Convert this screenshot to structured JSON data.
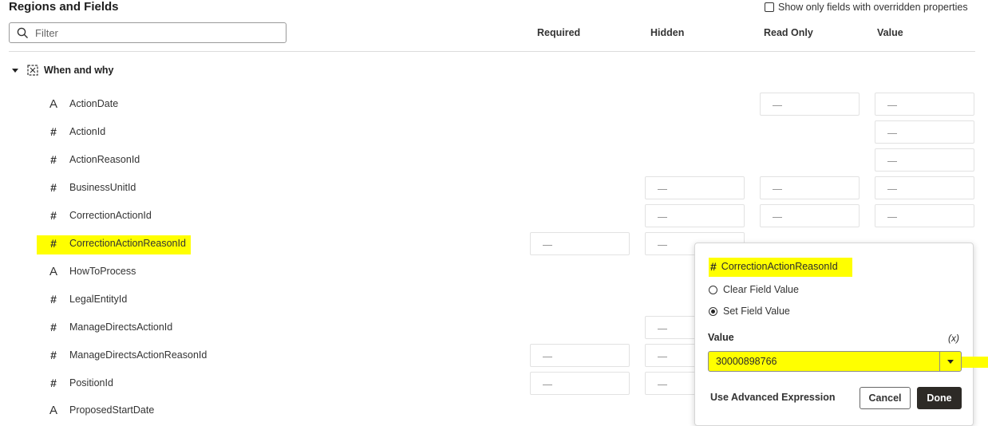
{
  "header": {
    "title": "Regions and Fields",
    "overridden_label": "Show only fields with overridden properties",
    "filter_placeholder": "Filter"
  },
  "columns": [
    "Required",
    "Hidden",
    "Read Only",
    "Value"
  ],
  "region": {
    "label": "When and why"
  },
  "fields": [
    {
      "name": "ActionDate",
      "type_icon": "text-icon"
    },
    {
      "name": "ActionId",
      "type_icon": "number-icon"
    },
    {
      "name": "ActionReasonId",
      "type_icon": "number-icon"
    },
    {
      "name": "BusinessUnitId",
      "type_icon": "number-icon"
    },
    {
      "name": "CorrectionActionId",
      "type_icon": "number-icon"
    },
    {
      "name": "CorrectionActionReasonId",
      "type_icon": "number-icon"
    },
    {
      "name": "HowToProcess",
      "type_icon": "text-icon"
    },
    {
      "name": "LegalEntityId",
      "type_icon": "number-icon"
    },
    {
      "name": "ManageDirectsActionId",
      "type_icon": "number-icon"
    },
    {
      "name": "ManageDirectsActionReasonId",
      "type_icon": "number-icon"
    },
    {
      "name": "PositionId",
      "type_icon": "number-icon"
    },
    {
      "name": "ProposedStartDate",
      "type_icon": "text-icon"
    }
  ],
  "popup": {
    "field_name": "CorrectionActionReasonId",
    "option_clear": "Clear Field Value",
    "option_set": "Set Field Value",
    "selected_option": "Set Field Value",
    "value_label": "Value",
    "expression_toggle": "(x)",
    "value": "30000898766",
    "advanced_label": "Use Advanced Expression",
    "cancel_label": "Cancel",
    "done_label": "Done"
  },
  "colors": {
    "highlight": "#ffff00",
    "done_bg": "#2d2a26"
  }
}
